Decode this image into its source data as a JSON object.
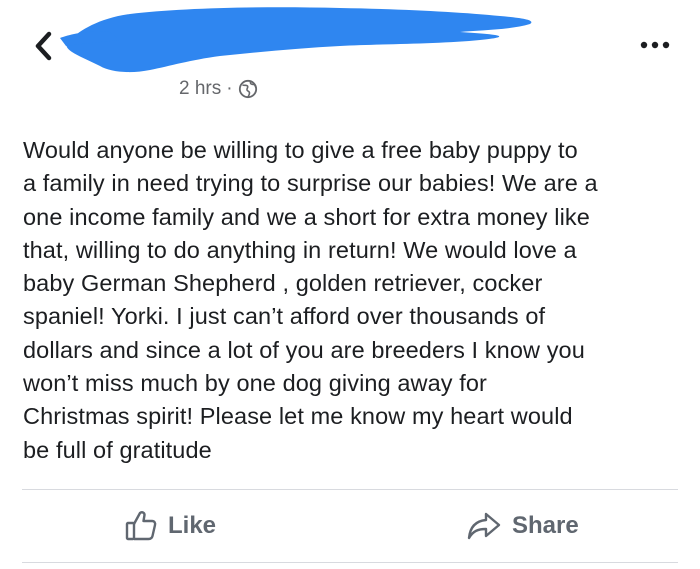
{
  "post": {
    "timestamp": "2 hrs",
    "separator": "·",
    "privacy_icon": "globe-icon",
    "body": "Would anyone be willing to give a free baby puppy to\na family in need trying to surprise our babies! We are a\none income family and we a short for extra money like\nthat, willing to do anything in return! We would love a\nbaby German Shepherd , golden retriever, cocker\nspaniel! Yorki. I just can’t afford over thousands of\ndollars and since a lot of you are breeders I know you\nwon’t miss much by one dog giving away for\nChristmas spirit! Please let me know my heart would\nbe full of gratitude"
  },
  "header": {
    "back_icon": "chevron-left-icon",
    "more_icon": "more-options-icon"
  },
  "actions": {
    "like_label": "Like",
    "share_label": "Share"
  },
  "colors": {
    "redaction": "#2f86f0",
    "text": "#1c1e21",
    "muted": "#65676b",
    "action": "#606770"
  }
}
